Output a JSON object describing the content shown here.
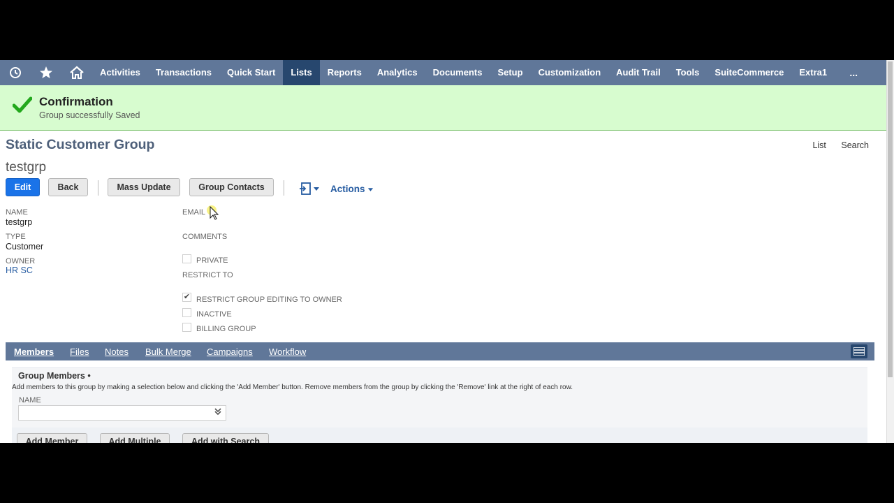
{
  "nav": {
    "icons": [
      "recent-icon",
      "star-icon",
      "home-icon"
    ],
    "items": [
      "Activities",
      "Transactions",
      "Quick Start",
      "Lists",
      "Reports",
      "Analytics",
      "Documents",
      "Setup",
      "Customization",
      "Audit Trail",
      "Tools",
      "SuiteCommerce",
      "Extra1"
    ],
    "active": "Lists",
    "more": "..."
  },
  "confirmation": {
    "title": "Confirmation",
    "message": "Group successfully Saved"
  },
  "header": {
    "page_title": "Static Customer Group",
    "record_name": "testgrp",
    "links": [
      "List",
      "Search"
    ]
  },
  "buttons": {
    "edit": "Edit",
    "back": "Back",
    "mass_update": "Mass Update",
    "group_contacts": "Group Contacts",
    "actions": "Actions"
  },
  "fields": {
    "name_label": "NAME",
    "name_value": "testgrp",
    "type_label": "TYPE",
    "type_value": "Customer",
    "owner_label": "OWNER",
    "owner_value": "HR SC",
    "email_label": "EMAIL",
    "comments_label": "COMMENTS",
    "private_label": "PRIVATE",
    "restrict_to_label": "RESTRICT TO",
    "restrict_editing_label": "RESTRICT GROUP EDITING TO OWNER",
    "inactive_label": "INACTIVE",
    "billing_group_label": "BILLING GROUP"
  },
  "checkbox_state": {
    "private": false,
    "restrict_editing": true,
    "inactive": false,
    "billing_group": false
  },
  "subtabs": {
    "items": [
      "Members",
      "Files",
      "Notes",
      "Bulk Merge",
      "Campaigns",
      "Workflow"
    ],
    "active": "Members"
  },
  "members": {
    "title": "Group Members •",
    "help": "Add members to this group by making a selection below and clicking the 'Add Member' button. Remove members from the group by clicking the 'Remove' link at the right of each row.",
    "name_label": "NAME",
    "add_member": "Add Member",
    "add_multiple": "Add Multiple",
    "add_with_search": "Add with Search"
  },
  "colors": {
    "nav_bg": "#607799",
    "nav_active": "#27476e",
    "confirm_bg": "#d7fccf",
    "check_green": "#22a81c",
    "primary_button": "#1a73e8",
    "link": "#255ba1"
  }
}
